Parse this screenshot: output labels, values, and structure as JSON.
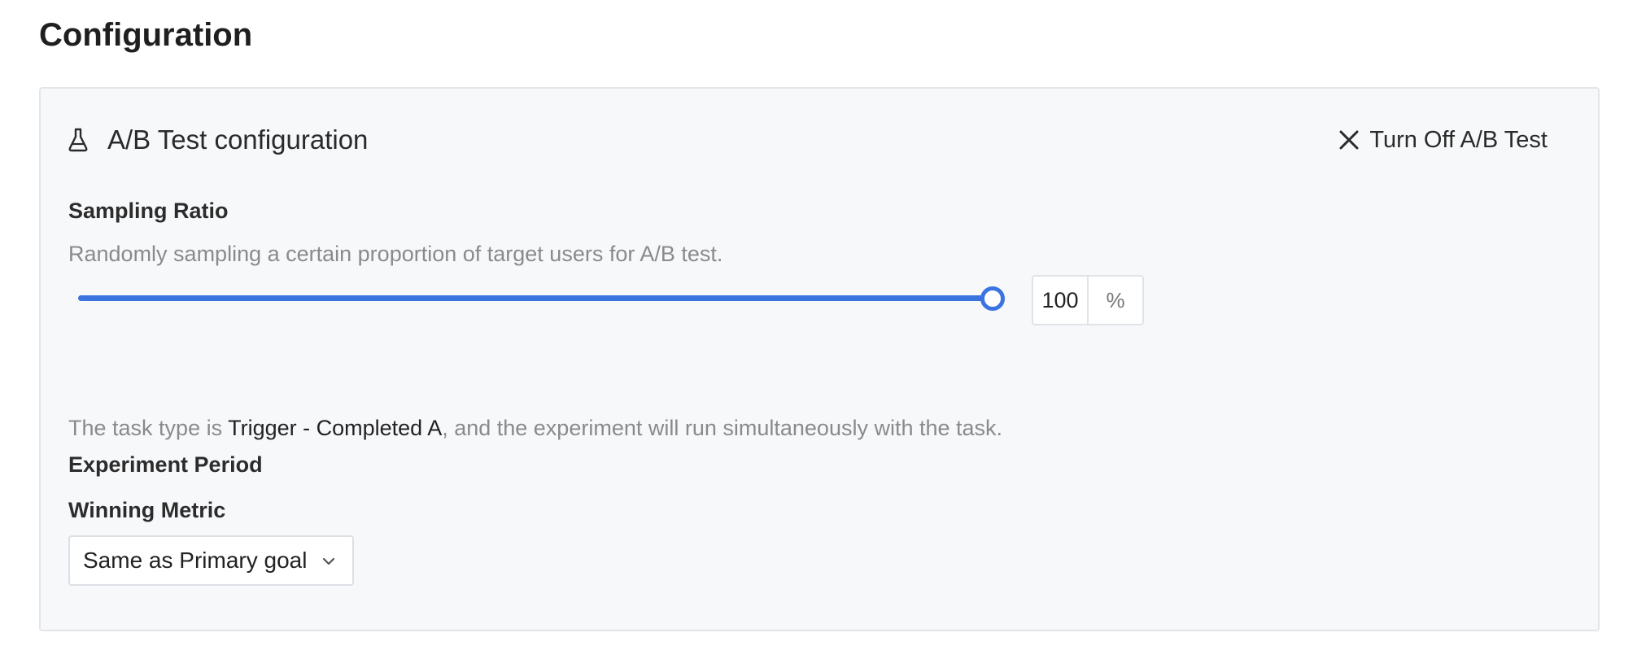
{
  "page": {
    "title": "Configuration"
  },
  "ab_test": {
    "icon": "flask-icon",
    "title": "A/B Test configuration",
    "turn_off": {
      "icon": "close-icon",
      "label": "Turn Off A/B Test"
    },
    "sampling": {
      "label": "Sampling Ratio",
      "description": "Randomly sampling a certain proportion of target users for A/B test.",
      "value": "100",
      "unit": "%",
      "slider_percent": 100
    },
    "period": {
      "label": "Experiment Period",
      "description_prefix": "The task type is ",
      "task_type": "Trigger - Completed A",
      "description_suffix": ", and the experiment will run simultaneously with the task."
    },
    "winning_metric": {
      "label": "Winning Metric",
      "selected": "Same as Primary goal",
      "icon": "chevron-down-icon"
    }
  },
  "colors": {
    "accent": "#3b73e0",
    "card_background": "#f7f8fa",
    "muted_text": "#8a8a8a"
  }
}
